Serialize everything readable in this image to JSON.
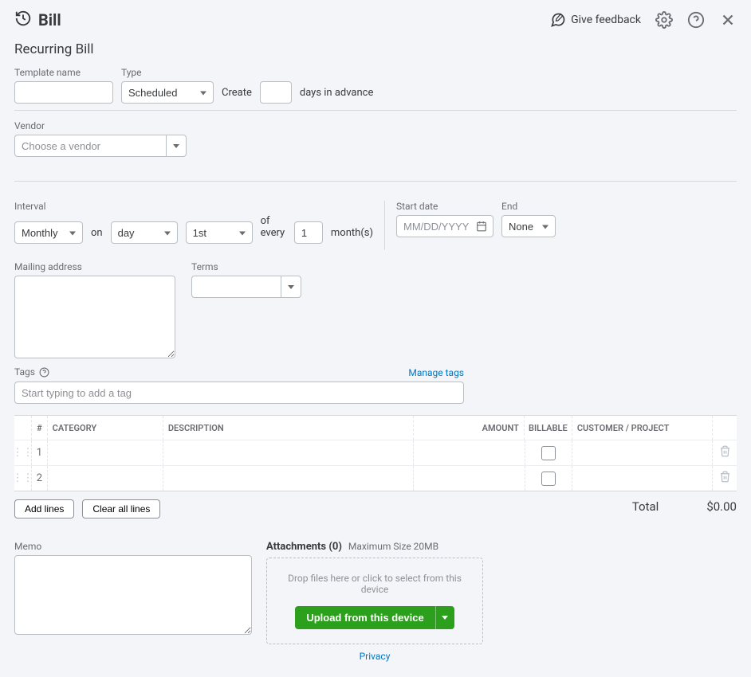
{
  "header": {
    "title": "Bill",
    "feedback_label": "Give feedback"
  },
  "form": {
    "title": "Recurring Bill",
    "template_name_label": "Template name",
    "template_name_value": "",
    "type_label": "Type",
    "type_value": "Scheduled",
    "create_prefix": "Create",
    "days_advance_value": "",
    "days_advance_suffix": "days in advance",
    "vendor_label": "Vendor",
    "vendor_placeholder": "Choose a vendor",
    "interval_label": "Interval",
    "interval_freq": "Monthly",
    "interval_on": "on",
    "interval_day": "day",
    "interval_ord": "1st",
    "interval_every": "of every",
    "interval_num": "1",
    "interval_unit": "month(s)",
    "start_date_label": "Start date",
    "start_date_placeholder": "MM/DD/YYYY",
    "end_label": "End",
    "end_value": "None",
    "mailing_label": "Mailing address",
    "mailing_value": "",
    "terms_label": "Terms",
    "terms_value": "",
    "tags_label": "Tags",
    "manage_tags": "Manage tags",
    "tags_placeholder": "Start typing to add a tag"
  },
  "table": {
    "headers": {
      "num": "#",
      "category": "CATEGORY",
      "description": "DESCRIPTION",
      "amount": "AMOUNT",
      "billable": "BILLABLE",
      "customer": "CUSTOMER / PROJECT"
    },
    "rows": [
      {
        "num": "1"
      },
      {
        "num": "2"
      }
    ],
    "add_lines": "Add lines",
    "clear_lines": "Clear all lines",
    "total_label": "Total",
    "total_value": "$0.00"
  },
  "memo": {
    "label": "Memo",
    "value": ""
  },
  "attachments": {
    "title": "Attachments",
    "count": "(0)",
    "max": "Maximum Size 20MB",
    "drop_text": "Drop files here or click to select from this device",
    "upload_label": "Upload from this device",
    "privacy": "Privacy"
  }
}
